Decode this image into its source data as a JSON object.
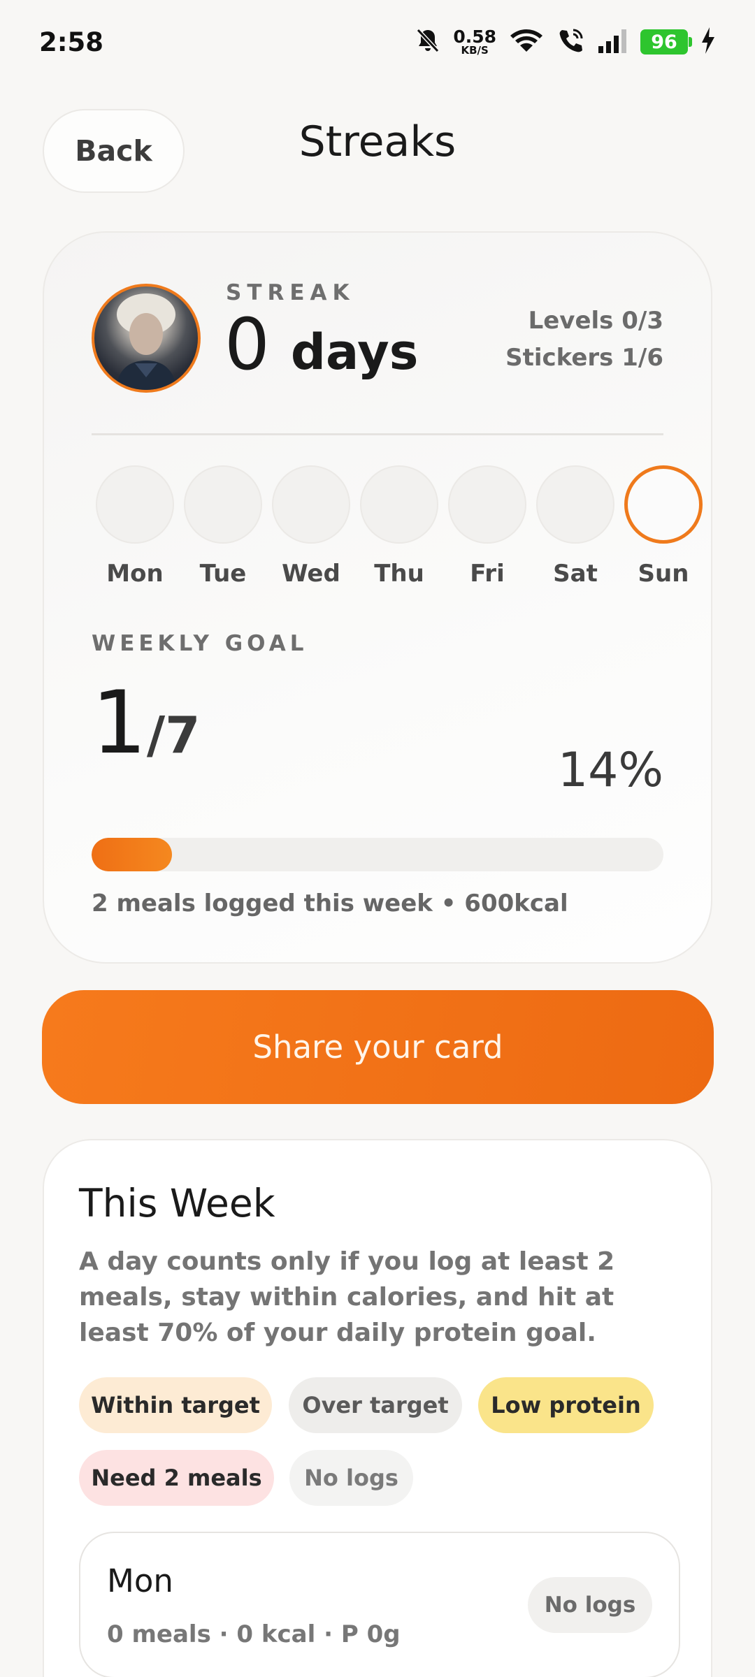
{
  "status_bar": {
    "time": "2:58",
    "net_speed_value": "0.58",
    "net_speed_unit": "KB/S",
    "battery": "96"
  },
  "header": {
    "back_label": "Back",
    "title": "Streaks"
  },
  "streak_card": {
    "label": "STREAK",
    "value": "0",
    "unit": "days",
    "levels": "Levels 0/3",
    "stickers": "Stickers 1/6",
    "days": [
      {
        "label": "Mon",
        "today": false
      },
      {
        "label": "Tue",
        "today": false
      },
      {
        "label": "Wed",
        "today": false
      },
      {
        "label": "Thu",
        "today": false
      },
      {
        "label": "Fri",
        "today": false
      },
      {
        "label": "Sat",
        "today": false
      },
      {
        "label": "Sun",
        "today": true
      }
    ],
    "weekly_goal_label": "WEEKLY GOAL",
    "goal_done": "1",
    "goal_total": "/7",
    "goal_percent": "14%",
    "goal_progress": 0.14,
    "note": "2 meals logged this week • 600kcal"
  },
  "share_button": "Share your card",
  "this_week": {
    "title": "This Week",
    "description": "A day counts only if you log at least 2 meals, stay within calories, and hit at least 70% of your daily protein goal.",
    "legend": [
      {
        "label": "Within target",
        "bg": "#fdebd4",
        "fg": "#2a2a2a"
      },
      {
        "label": "Over target",
        "bg": "#eeedeb",
        "fg": "#5a5a5a"
      },
      {
        "label": "Low protein",
        "bg": "#fae48a",
        "fg": "#2a2a2a"
      },
      {
        "label": "Need 2 meals",
        "bg": "#fde2e2",
        "fg": "#2a2a2a"
      },
      {
        "label": "No logs",
        "bg": "#f3f3f2",
        "fg": "#7a7a7a"
      }
    ],
    "rows": [
      {
        "day": "Mon",
        "summary": "0 meals · 0 kcal · P 0g",
        "status": "No logs"
      }
    ]
  },
  "colors": {
    "accent": "#f17516",
    "background": "#f8f7f5"
  }
}
